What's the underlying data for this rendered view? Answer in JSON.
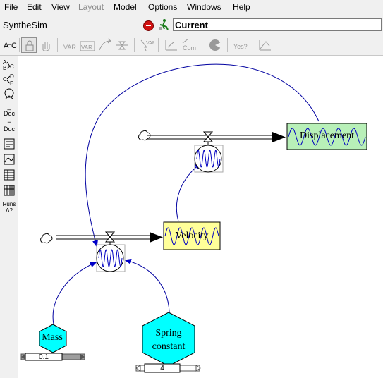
{
  "menu": {
    "file": "File",
    "edit": "Edit",
    "view": "View",
    "layout": "Layout",
    "model": "Model",
    "options": "Options",
    "windows": "Windows",
    "help": "Help"
  },
  "app": {
    "name": "SyntheSim"
  },
  "run": {
    "name": "Current"
  },
  "toolbar": {
    "tools": [
      "lock-icon",
      "hand-icon",
      "variable-tool",
      "box-variable-tool",
      "arrow-tool",
      "rate-tool",
      "shadow-variable-tool",
      "equation-tool",
      "comment-tool",
      "delete-tool",
      "sketch-tool",
      "sketch-comment-tool"
    ]
  },
  "sidebar": {
    "causes_tree": "Cause Tree",
    "uses_tree": "Uses Tree",
    "loops": "Loops",
    "doc": "Doc",
    "doc2": "Doc",
    "runs_label": "Runs"
  },
  "model": {
    "stock_velocity": "Velocity",
    "stock_displacement": "Displacement",
    "aux_mass": "Mass",
    "aux_spring_line1": "Spring",
    "aux_spring_line2": "constant",
    "slider_mass_value": "0.1",
    "slider_spring_value": "4"
  },
  "colors": {
    "stock_velocity_fill": "#ffff99",
    "stock_displacement_fill": "#b8f0b8",
    "aux_fill": "#00ffff",
    "link": "#0000b0",
    "sparkline": "#0000c0"
  }
}
